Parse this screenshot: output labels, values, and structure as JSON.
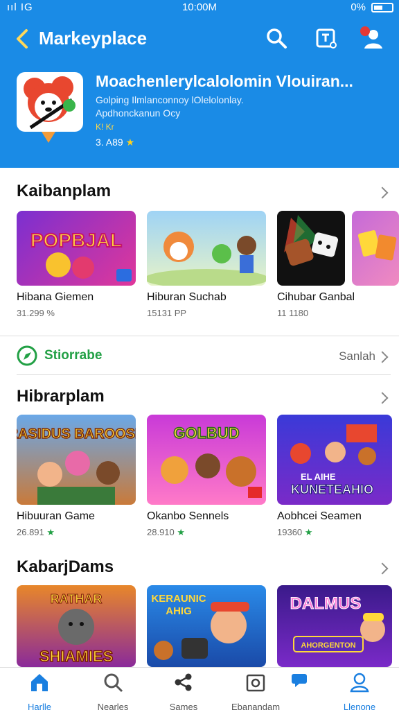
{
  "status_bar": {
    "signal": "ııl",
    "carrier": "IG",
    "time": "10:00M",
    "battery_text": "0%"
  },
  "navbar": {
    "title": "Markeyplace",
    "icons": [
      "back-chevron-icon",
      "search-icon",
      "edit-icon",
      "profile-icon"
    ]
  },
  "featured_app": {
    "title": "Moachenlerylcalolomin Vlouiran...",
    "line1": "Golping Ilmlanconnoy lOlelolonlay.",
    "line2": "Apdhonckanun Ocy",
    "line3": "K! Kr",
    "rating": "3. A89"
  },
  "sections": [
    {
      "title": "Kaibanplam",
      "cards": [
        {
          "name": "Hibana Giemen",
          "sub": "31.299 %"
        },
        {
          "name": "Hiburan Suchab",
          "sub": "15131 PP"
        },
        {
          "name": "Cihubar Ganbal",
          "sub": "11 1180"
        }
      ]
    },
    {
      "title": "Hibrarplam",
      "cards": [
        {
          "name": "Hibuuran Game",
          "sub": "26.891"
        },
        {
          "name": "Okanbo Sennels",
          "sub": "28.910"
        },
        {
          "name": "Aobhcei Seamen",
          "sub": "19360"
        }
      ]
    },
    {
      "title": "KabarjDams",
      "cards": [
        {
          "name": "",
          "sub": ""
        },
        {
          "name": "",
          "sub": ""
        },
        {
          "name": "",
          "sub": ""
        }
      ]
    }
  ],
  "feature_row": {
    "label": "Stiorrabe",
    "link": "Sanlah"
  },
  "thumb_text": {
    "t1": "POPBJAL",
    "t4": "RASIDUS BAROOSE",
    "t5": "GOLBUD",
    "t6a": "EL AIHE",
    "t6b": "KUNETEAHIO",
    "t7a": "RATHAR",
    "t7b": "SHIAMIES",
    "t8a": "KERAUNIC",
    "t8b": "AHIG",
    "t9a": "DALMUS",
    "t9b": "AHORGENTON"
  },
  "bottom_nav": [
    {
      "label": "Harlle",
      "icon": "home-icon",
      "active": true
    },
    {
      "label": "Nearles",
      "icon": "search-icon"
    },
    {
      "label": "Sames",
      "icon": "share-icon"
    },
    {
      "label": "Ebanandam",
      "icon": "library-icon"
    },
    {
      "label": "Llenone",
      "icon": "profile-icon",
      "active": true
    }
  ],
  "colors": {
    "header_blue": "#1a8be6",
    "accent_green": "#22a045",
    "active_blue": "#1a7fe0",
    "star_yellow": "#ffd21f"
  }
}
